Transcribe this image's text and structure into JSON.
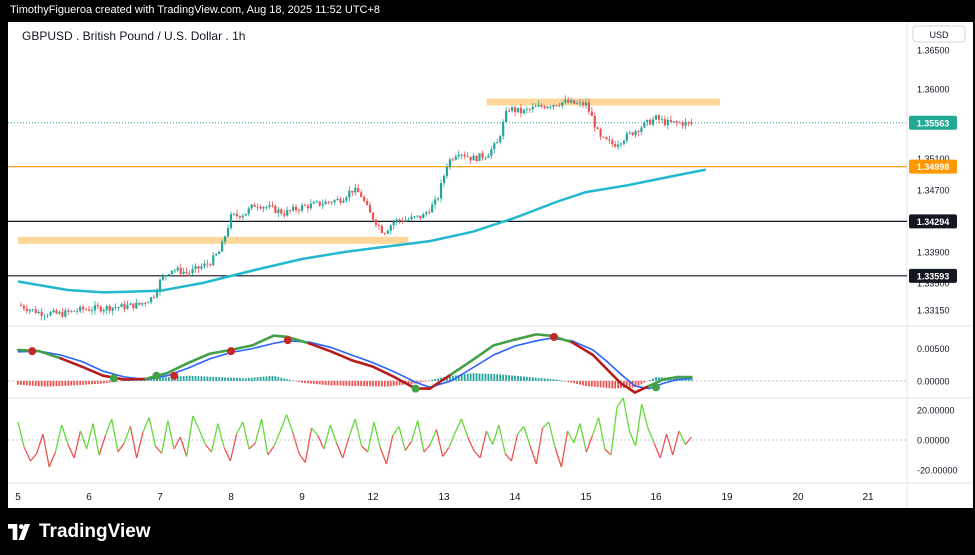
{
  "credit": "TimothyFigueroa created with TradingView.com, Aug 18, 2025 11:52 UTC+8",
  "brand": {
    "name": "TradingView",
    "logo_icon": "tradingview-logo-icon"
  },
  "colors": {
    "background": "#ffffff",
    "frame": "#000000",
    "candle_up": "#26a69a",
    "candle_down": "#ef5350",
    "ma": "#22b8cf",
    "zone": "#ffd699",
    "price_line": "#26a69a",
    "price_badge": "#22ab94",
    "orange": "#ff9800",
    "black": "#131722",
    "osc_green": "#43a047",
    "osc_red": "#b71c1c",
    "osc_blue": "#2962ff",
    "hist_green": "#26a69a",
    "hist_red": "#ef5350",
    "rsi_green": "#66d93a",
    "rsi_red": "#ef5350",
    "dot_red": "#c62828",
    "dot_green": "#43a047"
  },
  "chart_data": {
    "type": "candlestick",
    "title": "GBPUSD . British Pound / U.S. Dollar . 1h",
    "currency": "USD",
    "x_tick_labels": [
      "5",
      "6",
      "7",
      "8",
      "9",
      "12",
      "13",
      "14",
      "15",
      "16",
      "19",
      "20",
      "21"
    ],
    "price_axis": {
      "ylim": [
        1.3296,
        1.3686
      ],
      "ticks": [
        "1.36500",
        "1.36000",
        "1.35100",
        "1.34700",
        "1.33900",
        "1.33500",
        "1.33150"
      ],
      "tick_values": [
        1.365,
        1.36,
        1.351,
        1.347,
        1.339,
        1.335,
        1.3315
      ]
    },
    "price_labels": [
      {
        "label": "1.35563",
        "value": 1.35563,
        "style": "last-price",
        "color": "#22ab94"
      },
      {
        "label": "1.34998",
        "value": 1.34998,
        "style": "horizontal-line",
        "color": "#ff9800"
      },
      {
        "label": "1.34294",
        "value": 1.34294,
        "style": "horizontal-line",
        "color": "#131722"
      },
      {
        "label": "1.33593",
        "value": 1.33593,
        "style": "horizontal-line",
        "color": "#131722"
      }
    ],
    "zones": [
      {
        "from_day": 0.0,
        "to_day": 5.5,
        "value": 1.3405
      },
      {
        "from_day": 6.6,
        "to_day": 9.9,
        "value": 1.3583
      }
    ],
    "close_path": [
      [
        0.0,
        1.3322
      ],
      [
        0.3,
        1.3312
      ],
      [
        0.6,
        1.331
      ],
      [
        0.9,
        1.3316
      ],
      [
        1.2,
        1.3318
      ],
      [
        1.5,
        1.332
      ],
      [
        1.7,
        1.3322
      ],
      [
        1.9,
        1.3332
      ],
      [
        2.0,
        1.3352
      ],
      [
        2.15,
        1.3368
      ],
      [
        2.4,
        1.3363
      ],
      [
        2.7,
        1.3376
      ],
      [
        2.85,
        1.3392
      ],
      [
        3.0,
        1.3435
      ],
      [
        3.2,
        1.344
      ],
      [
        3.35,
        1.3452
      ],
      [
        3.5,
        1.3448
      ],
      [
        3.75,
        1.344
      ],
      [
        4.0,
        1.3448
      ],
      [
        4.3,
        1.3453
      ],
      [
        4.55,
        1.3458
      ],
      [
        4.7,
        1.347
      ],
      [
        4.82,
        1.3465
      ],
      [
        4.95,
        1.344
      ],
      [
        5.15,
        1.3415
      ],
      [
        5.3,
        1.343
      ],
      [
        5.5,
        1.3432
      ],
      [
        5.7,
        1.3436
      ],
      [
        5.9,
        1.3456
      ],
      [
        6.05,
        1.3505
      ],
      [
        6.2,
        1.352
      ],
      [
        6.4,
        1.351
      ],
      [
        6.6,
        1.3515
      ],
      [
        6.75,
        1.353
      ],
      [
        6.9,
        1.3575
      ],
      [
        7.1,
        1.357
      ],
      [
        7.3,
        1.3576
      ],
      [
        7.5,
        1.358
      ],
      [
        7.7,
        1.3583
      ],
      [
        7.9,
        1.358
      ],
      [
        8.0,
        1.358
      ],
      [
        8.1,
        1.356
      ],
      [
        8.2,
        1.3536
      ],
      [
        8.4,
        1.3528
      ],
      [
        8.6,
        1.354
      ],
      [
        8.8,
        1.3552
      ],
      [
        9.0,
        1.3562
      ],
      [
        9.15,
        1.3556
      ],
      [
        9.35,
        1.3556
      ],
      [
        9.5,
        1.3555
      ]
    ],
    "moving_average": [
      [
        0.0,
        1.3352
      ],
      [
        0.7,
        1.3341
      ],
      [
        1.2,
        1.3338
      ],
      [
        2.0,
        1.334
      ],
      [
        2.6,
        1.335
      ],
      [
        3.3,
        1.3366
      ],
      [
        4.0,
        1.3381
      ],
      [
        4.6,
        1.339
      ],
      [
        5.2,
        1.3397
      ],
      [
        5.8,
        1.3404
      ],
      [
        6.4,
        1.3416
      ],
      [
        7.0,
        1.3434
      ],
      [
        7.6,
        1.3455
      ],
      [
        8.0,
        1.3467
      ],
      [
        8.6,
        1.3476
      ],
      [
        9.2,
        1.3487
      ],
      [
        9.7,
        1.3496
      ]
    ],
    "oscillator": {
      "ylim": [
        -0.0025,
        0.0085
      ],
      "ticks": [
        "0.00500",
        "0.00000"
      ],
      "tick_values": [
        0.005,
        0.0
      ],
      "fast_line": [
        [
          0.0,
          0.0048
        ],
        [
          0.3,
          0.0046
        ],
        [
          0.6,
          0.0035
        ],
        [
          0.9,
          0.0022
        ],
        [
          1.2,
          0.0008
        ],
        [
          1.5,
          0.0002
        ],
        [
          1.8,
          0.0003
        ],
        [
          2.1,
          0.0012
        ],
        [
          2.4,
          0.0028
        ],
        [
          2.7,
          0.0042
        ],
        [
          3.0,
          0.0048
        ],
        [
          3.3,
          0.0055
        ],
        [
          3.6,
          0.007
        ],
        [
          3.8,
          0.0068
        ],
        [
          4.1,
          0.0058
        ],
        [
          4.4,
          0.0046
        ],
        [
          4.7,
          0.0032
        ],
        [
          5.0,
          0.0022
        ],
        [
          5.3,
          0.0006
        ],
        [
          5.6,
          -0.0012
        ],
        [
          5.8,
          -0.0012
        ],
        [
          6.1,
          0.001
        ],
        [
          6.4,
          0.0032
        ],
        [
          6.7,
          0.0055
        ],
        [
          7.0,
          0.0064
        ],
        [
          7.3,
          0.0072
        ],
        [
          7.5,
          0.007
        ],
        [
          7.8,
          0.006
        ],
        [
          8.1,
          0.004
        ],
        [
          8.3,
          0.0018
        ],
        [
          8.5,
          -0.0004
        ],
        [
          8.7,
          -0.0018
        ],
        [
          8.9,
          -0.0008
        ],
        [
          9.1,
          0.0002
        ],
        [
          9.3,
          0.0006
        ],
        [
          9.5,
          0.0006
        ]
      ],
      "signal_line": [
        [
          0.0,
          0.0045
        ],
        [
          0.3,
          0.0046
        ],
        [
          0.6,
          0.004
        ],
        [
          0.9,
          0.003
        ],
        [
          1.2,
          0.0015
        ],
        [
          1.5,
          0.0006
        ],
        [
          1.8,
          0.0002
        ],
        [
          2.1,
          0.0008
        ],
        [
          2.4,
          0.002
        ],
        [
          2.7,
          0.0034
        ],
        [
          3.0,
          0.0044
        ],
        [
          3.3,
          0.005
        ],
        [
          3.6,
          0.0058
        ],
        [
          3.8,
          0.0062
        ],
        [
          4.1,
          0.006
        ],
        [
          4.4,
          0.0052
        ],
        [
          4.7,
          0.004
        ],
        [
          5.0,
          0.0028
        ],
        [
          5.3,
          0.0014
        ],
        [
          5.6,
          -0.0002
        ],
        [
          5.8,
          -0.001
        ],
        [
          6.1,
          0.0
        ],
        [
          6.4,
          0.002
        ],
        [
          6.7,
          0.004
        ],
        [
          7.0,
          0.0054
        ],
        [
          7.3,
          0.0062
        ],
        [
          7.5,
          0.0066
        ],
        [
          7.8,
          0.0062
        ],
        [
          8.1,
          0.0048
        ],
        [
          8.3,
          0.003
        ],
        [
          8.5,
          0.001
        ],
        [
          8.7,
          -0.0008
        ],
        [
          8.9,
          -0.0012
        ],
        [
          9.1,
          -0.0004
        ],
        [
          9.3,
          0.0002
        ],
        [
          9.5,
          0.0004
        ]
      ],
      "histogram": [
        [
          0.0,
          -0.0006
        ],
        [
          0.4,
          -0.0009
        ],
        [
          0.8,
          -0.0007
        ],
        [
          1.2,
          -0.0004
        ],
        [
          1.6,
          0.0002
        ],
        [
          2.0,
          0.0005
        ],
        [
          2.4,
          0.0008
        ],
        [
          2.8,
          0.0006
        ],
        [
          3.2,
          0.0004
        ],
        [
          3.6,
          0.0008
        ],
        [
          4.0,
          -0.0003
        ],
        [
          4.4,
          -0.0007
        ],
        [
          4.8,
          -0.0008
        ],
        [
          5.2,
          -0.0009
        ],
        [
          5.6,
          -0.0004
        ],
        [
          6.0,
          0.0006
        ],
        [
          6.4,
          0.0012
        ],
        [
          6.8,
          0.001
        ],
        [
          7.2,
          0.0006
        ],
        [
          7.6,
          0.0002
        ],
        [
          8.0,
          -0.0008
        ],
        [
          8.4,
          -0.0012
        ],
        [
          8.7,
          -0.001
        ],
        [
          9.0,
          0.0006
        ],
        [
          9.3,
          0.0004
        ]
      ],
      "red_markers": [
        [
          0.2,
          0.0046
        ],
        [
          2.2,
          0.0008
        ],
        [
          3.0,
          0.0046
        ],
        [
          3.8,
          0.0063
        ],
        [
          7.55,
          0.0068
        ]
      ],
      "green_markers": [
        [
          1.35,
          0.0004
        ],
        [
          1.95,
          0.0008
        ],
        [
          5.6,
          -0.0012
        ],
        [
          9.0,
          -0.001
        ]
      ]
    },
    "rsi": {
      "ylim": [
        -28,
        28
      ],
      "ticks": [
        "20.00000",
        "0.00000",
        "-20.00000"
      ],
      "tick_values": [
        20,
        0,
        -20
      ],
      "values": [
        12,
        -5,
        -14,
        -9,
        4,
        -18,
        -8,
        10,
        -3,
        -12,
        6,
        -6,
        11,
        -10,
        3,
        14,
        -8,
        -2,
        9,
        -12,
        5,
        15,
        -4,
        -9,
        13,
        -6,
        2,
        -11,
        16,
        7,
        -3,
        -8,
        11,
        -5,
        -14,
        4,
        12,
        -6,
        -2,
        14,
        -10,
        -4,
        6,
        17,
        5,
        -9,
        -15,
        8,
        3,
        -6,
        10,
        -2,
        -12,
        2,
        14,
        -4,
        -8,
        12,
        -5,
        -16,
        3,
        9,
        -7,
        -1,
        13,
        -8,
        -3,
        7,
        -11,
        -5,
        5,
        14,
        2,
        -7,
        -12,
        6,
        -3,
        10,
        -9,
        -14,
        4,
        9,
        -4,
        -16,
        8,
        12,
        -5,
        -18,
        6,
        -2,
        11,
        -8,
        3,
        15,
        -6,
        -10,
        22,
        28,
        6,
        -4,
        24,
        8,
        -2,
        -12,
        4,
        -10,
        6,
        -3,
        2
      ],
      "green_threshold": 0
    }
  }
}
